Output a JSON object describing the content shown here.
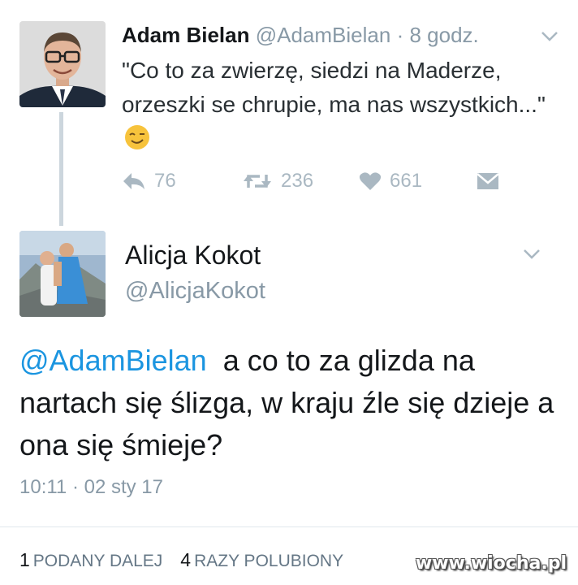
{
  "tweet1": {
    "name": "Adam Bielan",
    "handle": "@AdamBielan",
    "separator": "·",
    "time": "8 godz.",
    "text": "\"Co to za zwierzę, siedzi na Maderze, orzeszki se chrupie, ma nas wszystkich...\"",
    "replies": "76",
    "retweets": "236",
    "likes": "661"
  },
  "tweet2": {
    "name": "Alicja Kokot",
    "handle": "@AlicjaKokot",
    "mention": "@AdamBielan",
    "text": "a co to za glizda na nartach się ślizga, w kraju źle się dzieje a ona się śmieje?",
    "timestamp": "10:11 · 02 sty 17",
    "retweet_count": "1",
    "retweet_label": "PODANY DALEJ",
    "like_count": "4",
    "like_label": "RAZY POLUBIONY"
  },
  "watermark": "www.wiocha.pl",
  "colors": {
    "link": "#1b95e0",
    "secondary_text": "#8899a6",
    "action_icon": "#aab8c2",
    "thread_line": "#ccd6dd"
  },
  "icons": [
    "chevron-down-icon",
    "reply-icon",
    "retweet-icon",
    "heart-icon",
    "direct-message-icon",
    "wink-emoji-icon"
  ]
}
